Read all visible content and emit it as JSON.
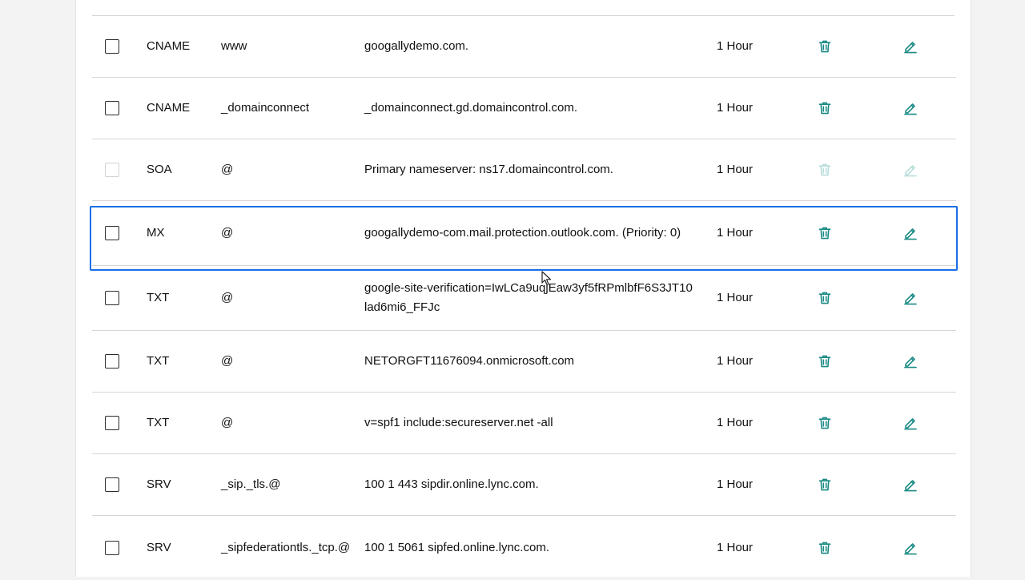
{
  "records": [
    {
      "type": "CNAME",
      "name": "www",
      "data": "googallydemo.com.",
      "ttl": "1 Hour"
    },
    {
      "type": "CNAME",
      "name": "_domainconnect",
      "data": "_domainconnect.gd.domaincontrol.com.",
      "ttl": "1 Hour"
    },
    {
      "type": "SOA",
      "name": "@",
      "data": "Primary nameserver: ns17.domaincontrol.com.",
      "ttl": "1 Hour"
    },
    {
      "type": "MX",
      "name": "@",
      "data": "googallydemo-com.mail.protection.outlook.com. (Priority: 0)",
      "ttl": "1 Hour"
    },
    {
      "type": "TXT",
      "name": "@",
      "data": "google-site-verification=IwLCa9uqjEaw3yf5fRPmlbfF6S3JT10lad6mi6_FFJc",
      "ttl": "1 Hour"
    },
    {
      "type": "TXT",
      "name": "@",
      "data": "NETORGFT11676094.onmicrosoft.com",
      "ttl": "1 Hour"
    },
    {
      "type": "TXT",
      "name": "@",
      "data": "v=spf1 include:secureserver.net -all",
      "ttl": "1 Hour"
    },
    {
      "type": "SRV",
      "name": "_sip._tls.@",
      "data": "100 1 443 sipdir.online.lync.com.",
      "ttl": "1 Hour"
    },
    {
      "type": "SRV",
      "name": "_sipfederationtls._tcp.@",
      "data": "100 1 5061 sipfed.online.lync.com.",
      "ttl": "1 Hour"
    }
  ],
  "icons": {
    "delete": "trash-icon",
    "edit": "pencil-icon"
  },
  "colors": {
    "accent": "#1b8a84",
    "highlight": "#1a6fe6"
  }
}
